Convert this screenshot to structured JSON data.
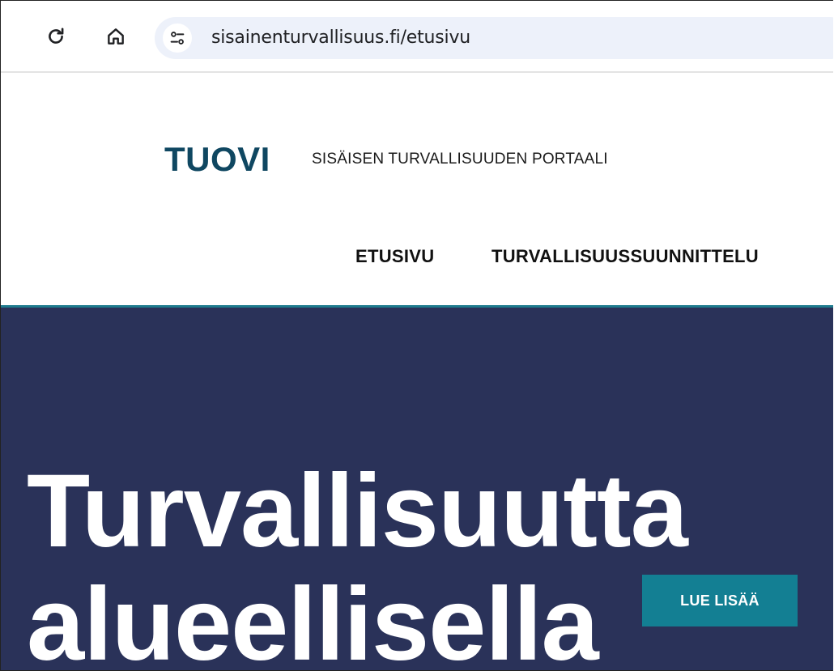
{
  "browser": {
    "url": "sisainenturvallisuus.fi/etusivu",
    "icons": {
      "reload": "reload-icon",
      "home": "home-icon",
      "site_info": "site-settings-icon"
    }
  },
  "header": {
    "logo": "TUOVI",
    "tagline": "SISÄISEN TURVALLISUUDEN PORTAALI",
    "nav": [
      "ETUSIVU",
      "TURVALLISUUSSUUNNITTELU"
    ]
  },
  "hero": {
    "title_lines": [
      "Turvallisuutta",
      "alueellisella"
    ],
    "cta_label": "LUE LISÄÄ"
  },
  "colors": {
    "logo": "#0f4761",
    "hero_background": "#2a3259",
    "accent_line": "#1f7c8e",
    "cta_background": "#137f93"
  }
}
